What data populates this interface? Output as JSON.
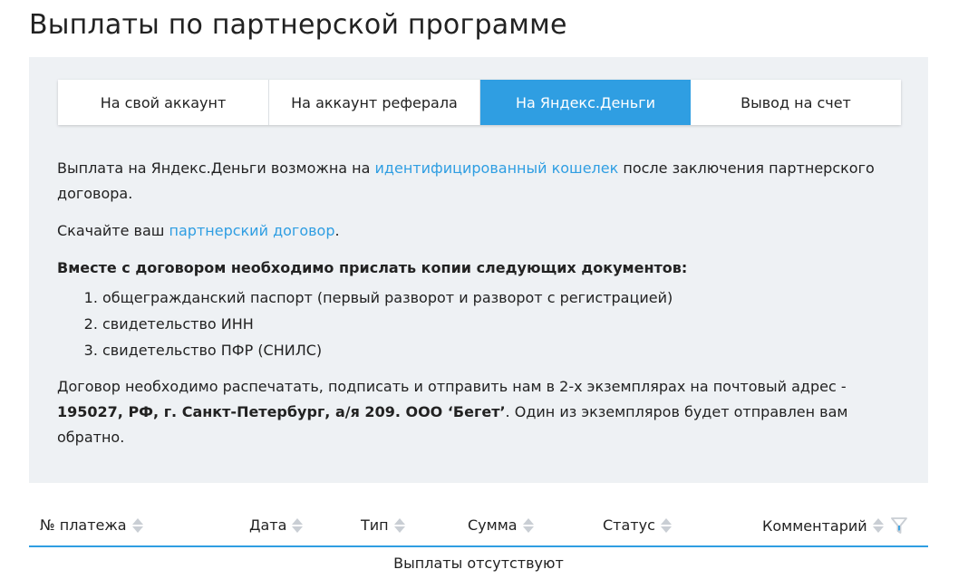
{
  "page": {
    "title": "Выплаты по партнерской программе"
  },
  "tabs": [
    {
      "label": "На свой аккаунт",
      "active": false
    },
    {
      "label": "На аккаунт реферала",
      "active": false
    },
    {
      "label": "На Яндекс.Деньги",
      "active": true
    },
    {
      "label": "Вывод на счет",
      "active": false
    }
  ],
  "content": {
    "para1_before": "Выплата на Яндекс.Деньги возможна на ",
    "para1_link": "идентифицированный кошелек",
    "para1_after": " после заключения партнерского договора.",
    "para2_before": "Скачайте ваш ",
    "para2_link": "партнерский договор",
    "para2_after": ".",
    "docs_heading": "Вместе с договором необходимо прислать копии следующих документов:",
    "docs": [
      "общегражданский паспорт (первый разворот и разворот с регистрацией)",
      "свидетельство ИНН",
      "свидетельство ПФР (СНИЛС)"
    ],
    "para4_before": "Договор необходимо распечатать, подписать и отправить нам в 2-х экземплярах на почтовый адрес - ",
    "address": "195027, РФ, г. Санкт-Петербург, а/я 209. ООО ‘Бегет’",
    "para4_after": ". Один из экземпляров будет отправлен вам обратно."
  },
  "table": {
    "columns": [
      "№ платежа",
      "Дата",
      "Тип",
      "Сумма",
      "Статус",
      "Комментарий"
    ],
    "empty_text": "Выплаты отсутствуют"
  },
  "colors": {
    "accent": "#2f9ee2",
    "panel_bg": "#eef1f4",
    "sort_icon": "#c9ced4"
  }
}
